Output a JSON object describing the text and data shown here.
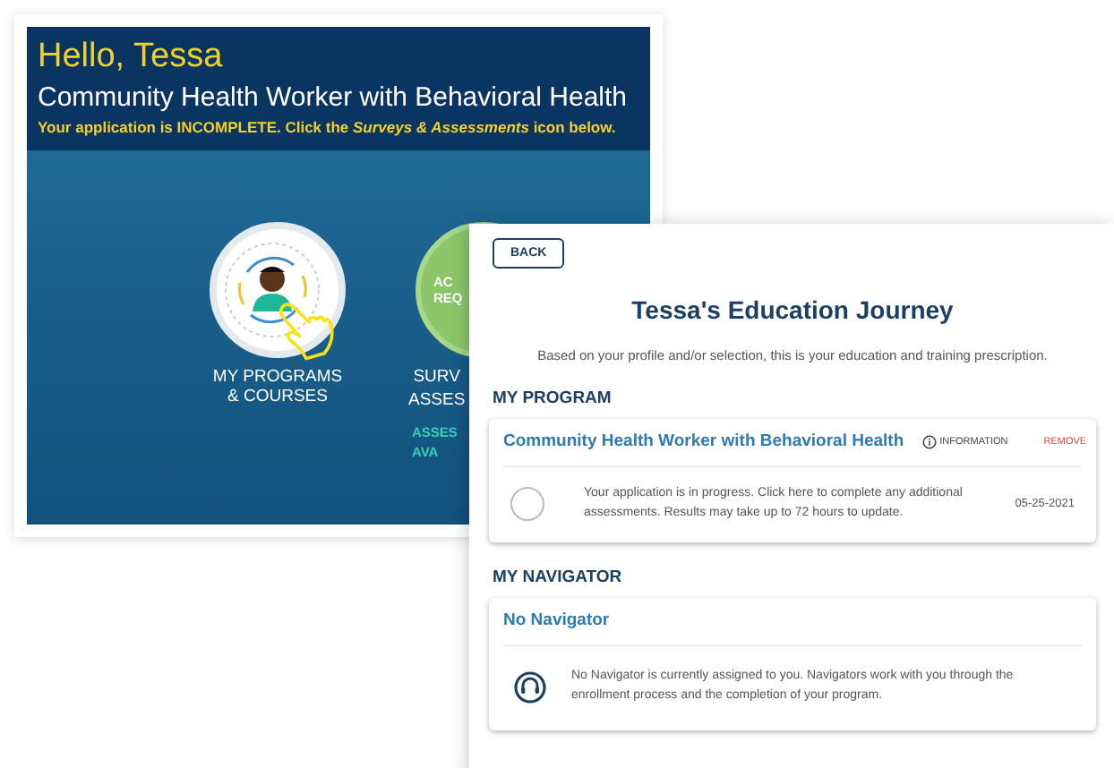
{
  "greeting": {
    "title": "Hello, Tessa",
    "program": "Community Health Worker with Behavioral Health",
    "notice": "Your application is INCOMPLETE. Click the *Surveys & Assessments* icon below."
  },
  "tiles": [
    {
      "kind": "programs",
      "label_lines": [
        "MY PROGRAMS",
        "& COURSES"
      ]
    },
    {
      "kind": "surveys",
      "badge_lines": [
        "AC",
        "REQ"
      ],
      "label_lines": [
        "SURV",
        "ASSES"
      ],
      "status_lines": [
        "ASSES",
        "AVA"
      ]
    }
  ],
  "journey": {
    "back_button": "BACK",
    "title": "Tessa's Education Journey",
    "subtitle": "Based on your profile and/or selection, this is your education and training prescription.",
    "sections": [
      {
        "kind": "program",
        "heading": "MY PROGRAM",
        "card": {
          "title": "Community Health Worker with Behavioral Health",
          "info": "INFORMATION",
          "remove": "REMOVE",
          "message": "Your application is in progress. Click here to complete any additional assessments. Results may take up to 72 hours to update.",
          "date": "05-25-2021"
        }
      },
      {
        "kind": "navigator",
        "heading": "MY NAVIGATOR",
        "card": {
          "title": "No Navigator",
          "message": "No Navigator is currently assigned to you. Navigators work with you through the enrollment process and the completion of your program."
        }
      }
    ]
  }
}
